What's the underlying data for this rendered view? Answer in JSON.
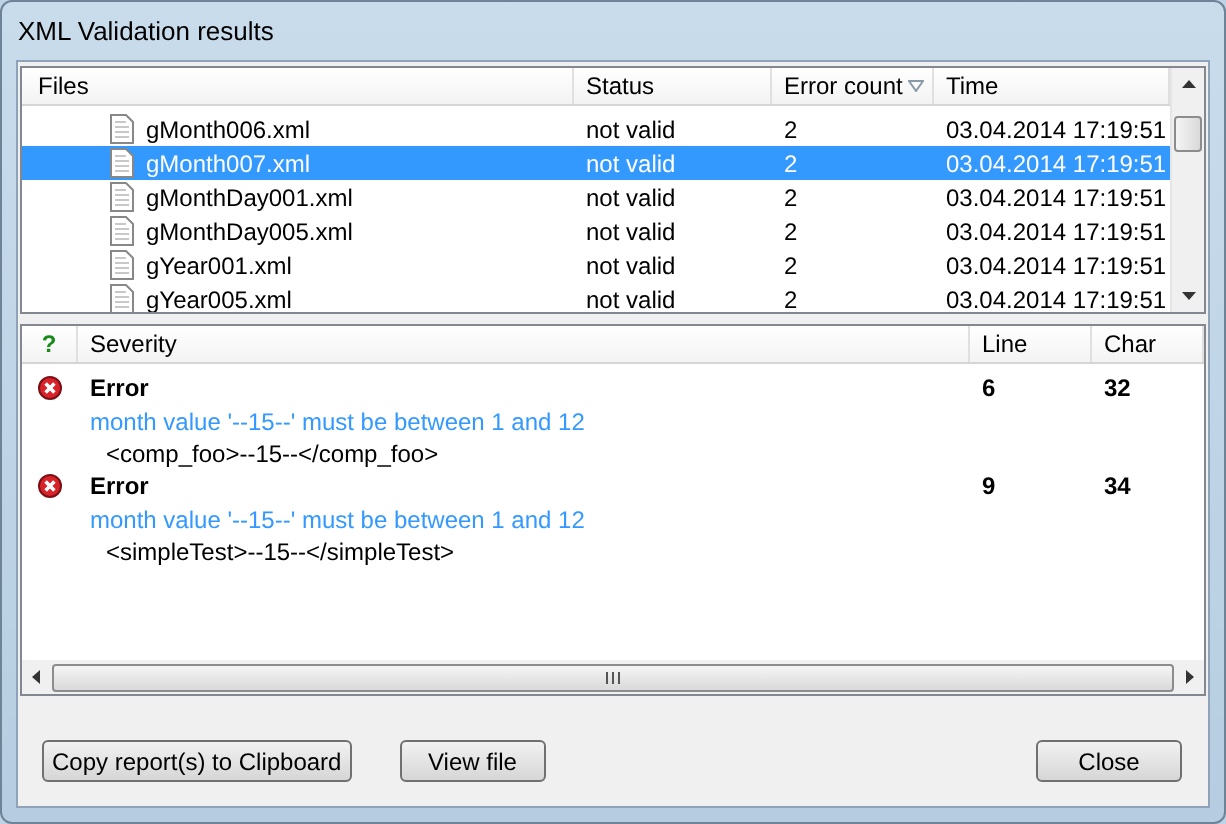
{
  "window": {
    "title": "XML Validation results"
  },
  "files": {
    "columns": [
      {
        "label": "Files",
        "sorted": false
      },
      {
        "label": "Status",
        "sorted": false
      },
      {
        "label": "Error count",
        "sorted": true
      },
      {
        "label": "Time",
        "sorted": false
      }
    ],
    "rows": [
      {
        "file": "gMonth006.xml",
        "status": "not valid",
        "errors": "2",
        "time": "03.04.2014 17:19:51",
        "selected": false
      },
      {
        "file": "gMonth007.xml",
        "status": "not valid",
        "errors": "2",
        "time": "03.04.2014 17:19:51",
        "selected": true
      },
      {
        "file": "gMonthDay001.xml",
        "status": "not valid",
        "errors": "2",
        "time": "03.04.2014 17:19:51",
        "selected": false
      },
      {
        "file": "gMonthDay005.xml",
        "status": "not valid",
        "errors": "2",
        "time": "03.04.2014 17:19:51",
        "selected": false
      },
      {
        "file": "gYear001.xml",
        "status": "not valid",
        "errors": "2",
        "time": "03.04.2014 17:19:51",
        "selected": false
      },
      {
        "file": "gYear005.xml",
        "status": "not valid",
        "errors": "2",
        "time": "03.04.2014 17:19:51",
        "selected": false
      }
    ]
  },
  "messages": {
    "columns": [
      "?",
      "Severity",
      "Line",
      "Char"
    ],
    "rows": [
      {
        "kind": "error",
        "severity": "Error",
        "line": "6",
        "char": "32",
        "message": "month value '--15--' must be between 1 and 12",
        "source": "<comp_foo>--15--</comp_foo>"
      },
      {
        "kind": "error",
        "severity": "Error",
        "line": "9",
        "char": "34",
        "message": "month value '--15--' must be between 1 and 12",
        "source": "<simpleTest>--15--</simpleTest>"
      }
    ]
  },
  "buttons": [
    "Copy report(s) to Clipboard",
    "View file",
    "Close"
  ]
}
